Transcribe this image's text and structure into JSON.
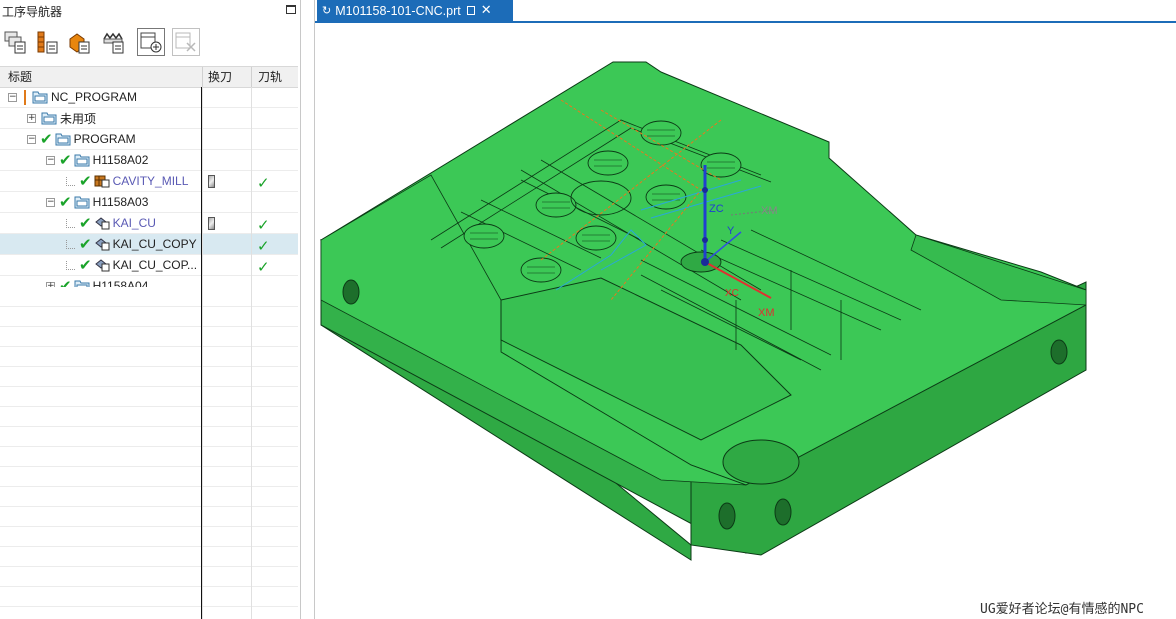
{
  "navigator": {
    "title": "工序导航器",
    "toolbar": [
      "program-order-view-icon",
      "machine-tool-view-icon",
      "geometry-view-icon",
      "method-view-icon",
      "create-operation-icon",
      "delete-operation-icon"
    ],
    "columns": {
      "name": "标题",
      "tool_change": "换刀",
      "toolpath": "刀轨"
    },
    "tree": [
      {
        "label": "NC_PROGRAM",
        "level": 0,
        "expander": "−",
        "check": false,
        "type": "root",
        "tool_change": false,
        "toolpath": false
      },
      {
        "label": "未用项",
        "level": 1,
        "expander": "+",
        "check": false,
        "type": "group",
        "tool_change": false,
        "toolpath": false
      },
      {
        "label": "PROGRAM",
        "level": 1,
        "expander": "−",
        "check": true,
        "type": "group",
        "tool_change": false,
        "toolpath": false
      },
      {
        "label": "H1158A02",
        "level": 2,
        "expander": "−",
        "check": true,
        "type": "group",
        "tool_change": false,
        "toolpath": false
      },
      {
        "label": "CAVITY_MILL",
        "level": 3,
        "expander": "",
        "check": true,
        "type": "op-cavity",
        "tool_change": true,
        "toolpath": true,
        "blue": true
      },
      {
        "label": "H1158A03",
        "level": 2,
        "expander": "−",
        "check": true,
        "type": "group",
        "tool_change": false,
        "toolpath": false
      },
      {
        "label": "KAI_CU",
        "level": 3,
        "expander": "",
        "check": true,
        "type": "op-mill",
        "tool_change": true,
        "toolpath": true,
        "blue": true
      },
      {
        "label": "KAI_CU_COPY",
        "level": 3,
        "expander": "",
        "check": true,
        "type": "op-mill",
        "tool_change": false,
        "toolpath": true,
        "selected": true
      },
      {
        "label": "KAI_CU_COP...",
        "level": 3,
        "expander": "",
        "check": true,
        "type": "op-mill",
        "tool_change": false,
        "toolpath": true
      },
      {
        "label": "H1158A04",
        "level": 2,
        "expander": "+",
        "check": true,
        "type": "group",
        "tool_change": false,
        "toolpath": false
      }
    ]
  },
  "graphics": {
    "tab_title": "M101158-101-CNC.prt",
    "tab_icon": "sync-icon",
    "axis_labels": {
      "zc": "ZC",
      "y": "Y",
      "xc": "XC",
      "xm": "XM",
      "xm2": "XM"
    },
    "colors": {
      "part": "#3cc856",
      "part_edge": "#0b3a15",
      "toolpath": "#e8781e",
      "axis_x": "#e03030",
      "axis_y": "#3050e0",
      "axis_z": "#2040d0",
      "tab": "#1c6cb8"
    }
  },
  "watermark": "UG爱好者论坛@有情感的NPC"
}
